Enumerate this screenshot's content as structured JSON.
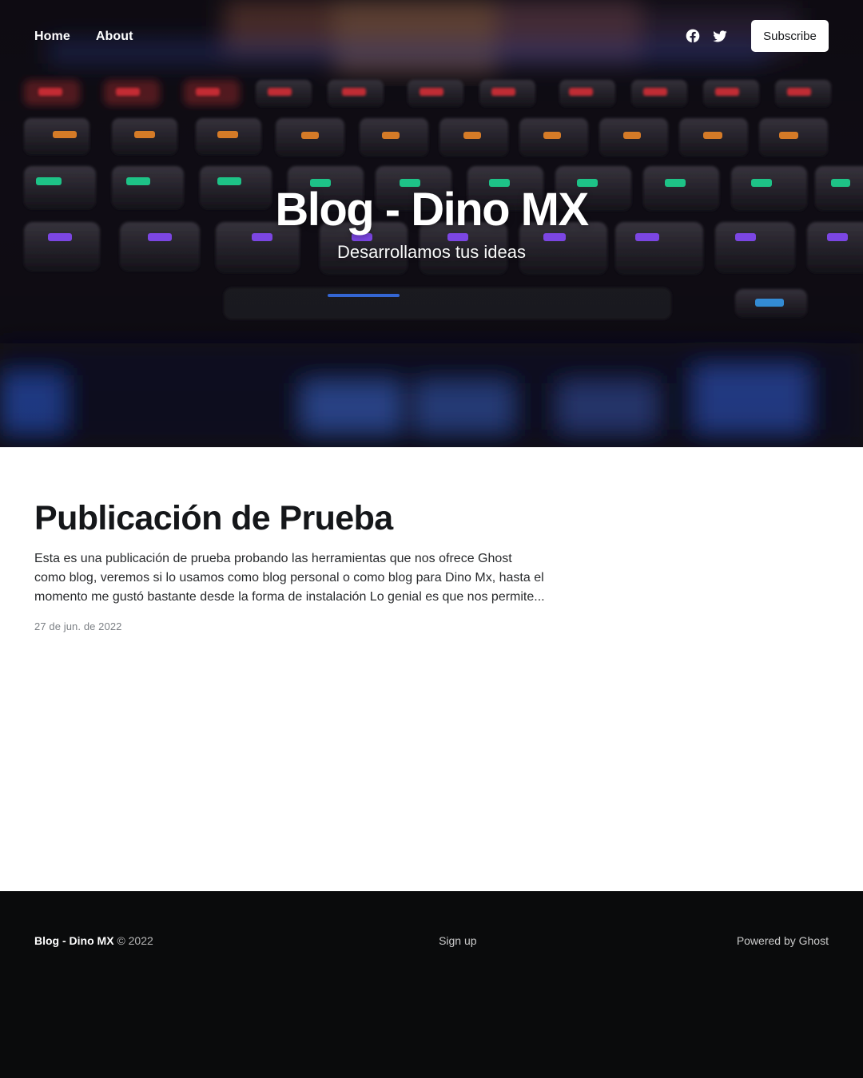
{
  "nav": {
    "links": [
      "Home",
      "About"
    ],
    "social": {
      "facebook": "facebook-icon",
      "twitter": "twitter-icon"
    },
    "subscribe_label": "Subscribe"
  },
  "hero": {
    "title": "Blog - Dino MX",
    "description": "Desarrollamos tus ideas",
    "background": "keyboard-photo"
  },
  "posts": [
    {
      "title": "Publicación de Prueba",
      "excerpt": "Esta es una publicación de prueba probando las herramientas que nos ofrece Ghost como blog, veremos si lo usamos como blog personal o como blog para Dino Mx, hasta el momento me gustó bastante desde la forma de instalación Lo genial es que nos permite...",
      "date": "27 de jun. de 2022"
    }
  ],
  "footer": {
    "brand": "Blog - Dino MX",
    "copyright": "© 2022",
    "signup_label": "Sign up",
    "powered_by": "Powered by Ghost"
  },
  "colors": {
    "footer_bg": "#0a0b0c",
    "text_dark": "#15171a",
    "date_gray": "#7c8085"
  }
}
